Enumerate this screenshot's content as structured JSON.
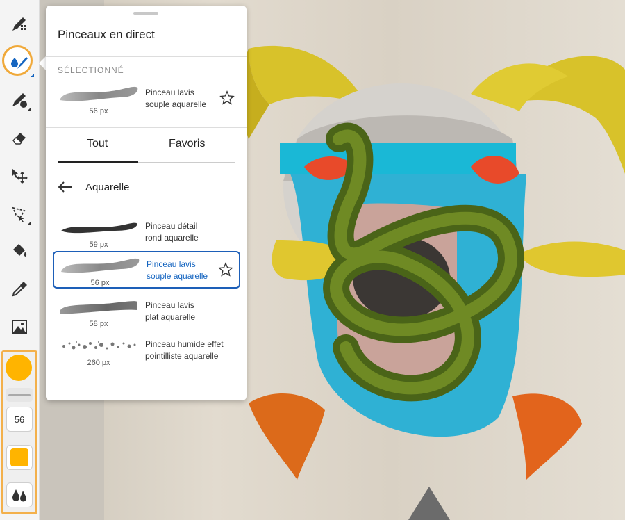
{
  "panel": {
    "title": "Pinceaux en direct",
    "selected_label": "SÉLECTIONNÉ",
    "selected_brush": {
      "name_line1": "Pinceau lavis",
      "name_line2": "souple aquarelle",
      "size": "56 px"
    },
    "tabs": [
      {
        "label": "Tout"
      },
      {
        "label": "Favoris"
      }
    ],
    "category": "Aquarelle",
    "brushes": [
      {
        "name_line1": "Pinceau détail",
        "name_line2": "rond aquarelle",
        "size": "59 px"
      },
      {
        "name_line1": "Pinceau lavis",
        "name_line2": "souple aquarelle",
        "size": "56 px",
        "selected": true
      },
      {
        "name_line1": "Pinceau lavis",
        "name_line2": "plat aquarelle",
        "size": "58 px"
      },
      {
        "name_line1": "Pinceau humide effet",
        "name_line2": "pointilliste aquarelle",
        "size": "260 px"
      }
    ]
  },
  "toolbar": {
    "tools": [
      "pixel-brush-icon",
      "live-brush-icon",
      "vector-brush-icon",
      "eraser-icon",
      "move-icon",
      "lasso-icon",
      "fill-icon",
      "eyedropper-icon",
      "image-icon"
    ],
    "brush_size": "56",
    "current_color": "#ffb400",
    "accent_color": "#f0a93a",
    "selection_color": "#1565c0"
  }
}
